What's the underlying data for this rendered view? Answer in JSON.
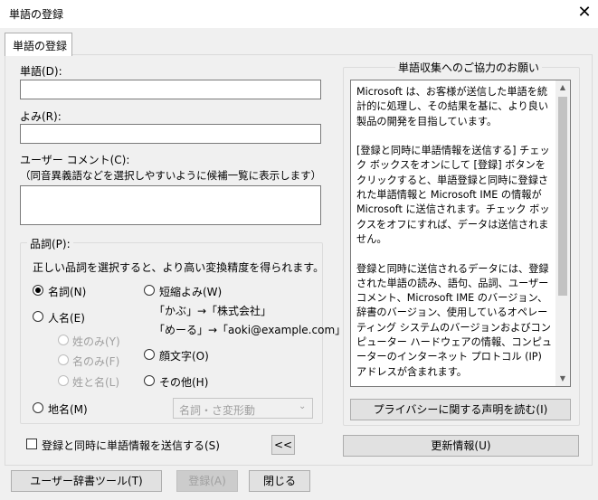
{
  "window": {
    "title": "単語の登録",
    "close_glyph": "✕"
  },
  "tab": {
    "label": "単語の登録"
  },
  "word": {
    "label": "単語(D):",
    "value": ""
  },
  "reading": {
    "label": "よみ(R):",
    "value": ""
  },
  "comment": {
    "label": "ユーザー コメント(C):",
    "hint": "（同音異義語などを選択しやすいように候補一覧に表示します）",
    "value": ""
  },
  "pos": {
    "legend": "品詞(P):",
    "description": "正しい品詞を選択すると、より高い変換精度を得られます。",
    "noun": "名詞(N)",
    "person": "人名(E)",
    "surname_only": "姓のみ(Y)",
    "given_only": "名のみ(F)",
    "full_name": "姓と名(L)",
    "place": "地名(M)",
    "short_reading": "短縮よみ(W)",
    "example1": "「かぶ」→「株式会社」",
    "example2": "「めーる」→「aoki@example.com」",
    "emoticon": "顔文字(O)",
    "other": "その他(H)",
    "other_select": "名詞・さ変形動"
  },
  "send_check": {
    "label": "登録と同時に単語情報を送信する(S)"
  },
  "collapse_button": "<<",
  "info": {
    "legend": "単語収集へのご協力のお願い",
    "text": "Microsoft は、お客様が送信した単語を統計的に処理し、その結果を基に、より良い製品の開発を目指しています。\n\n[登録と同時に単語情報を送信する] チェック ボックスをオンにして [登録] ボタンをクリックすると、単語登録と同時に登録された単語情報と Microsoft IME の情報が Microsoft に送信されます。チェック ボックスをオフにすれば、データは送信されません。\n\n登録と同時に送信されるデータには、登録された単語の読み、語句、品詞、ユーザー コメント、Microsoft IME のバージョン、辞書のバージョン、使用しているオペレーティング システムのバージョンおよびコンピューター ハードウェアの情報、コンピューターのインターネット プロトコル (IP) アドレスが含まれます。\n\nお客様特有の情報が収集されたデータに含まれることがあります。このような情報が存在する場合でも、Microsoft では、お客様を特定するために使用することはありません。",
    "privacy_button": "プライバシーに関する声明を読む(I)",
    "update_button": "更新情報(U)",
    "scroll_up": "▲",
    "scroll_down": "▼"
  },
  "footer": {
    "user_dict_button": "ユーザー辞書ツール(T)",
    "register_button": "登録(A)",
    "close_button": "閉じる"
  }
}
